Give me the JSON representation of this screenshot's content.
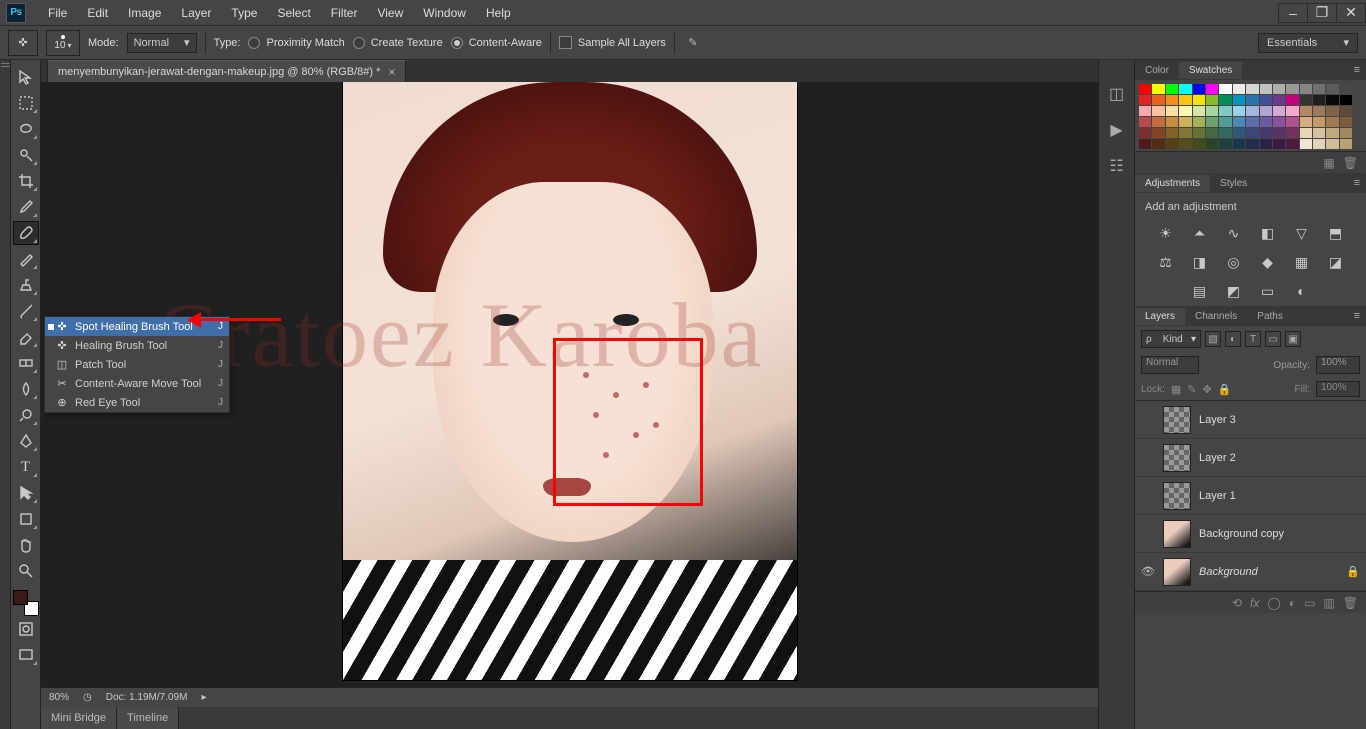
{
  "app": {
    "logo": "Ps"
  },
  "menu": [
    "File",
    "Edit",
    "Image",
    "Layer",
    "Type",
    "Select",
    "Filter",
    "View",
    "Window",
    "Help"
  ],
  "window_controls": [
    "–",
    "❐",
    "✕"
  ],
  "options": {
    "brush_size": "10",
    "mode_label": "Mode:",
    "mode_value": "Normal",
    "type_label": "Type:",
    "radios": [
      {
        "label": "Proximity Match",
        "on": false
      },
      {
        "label": "Create Texture",
        "on": false
      },
      {
        "label": "Content-Aware",
        "on": true
      }
    ],
    "sample_all": "Sample All Layers",
    "workspace": "Essentials"
  },
  "document": {
    "tab_title": "menyembunyikan-jerawat-dengan-makeup.jpg @ 80% (RGB/8#) *",
    "zoom": "80%",
    "doc_info": "Doc: 1.19M/7.09M"
  },
  "flyout": {
    "items": [
      {
        "label": "Spot Healing Brush Tool",
        "key": "J",
        "sel": true
      },
      {
        "label": "Healing Brush Tool",
        "key": "J",
        "sel": false
      },
      {
        "label": "Patch Tool",
        "key": "J",
        "sel": false
      },
      {
        "label": "Content-Aware Move Tool",
        "key": "J",
        "sel": false
      },
      {
        "label": "Red Eye Tool",
        "key": "J",
        "sel": false
      }
    ]
  },
  "bottom_tabs": [
    "Mini Bridge",
    "Timeline"
  ],
  "watermark": "Cratoez Karoba",
  "right": {
    "color_tabs": [
      "Color",
      "Swatches"
    ],
    "adjustments_tabs": [
      "Adjustments",
      "Styles"
    ],
    "adjustments_label": "Add an adjustment",
    "layers_tabs": [
      "Layers",
      "Channels",
      "Paths"
    ],
    "layers": {
      "kind_label": "Kind",
      "blend_mode": "Normal",
      "opacity_label": "Opacity:",
      "opacity_value": "100%",
      "lock_label": "Lock:",
      "fill_label": "Fill:",
      "fill_value": "100%",
      "items": [
        {
          "name": "Layer 3",
          "visible": false,
          "img": false
        },
        {
          "name": "Layer 2",
          "visible": false,
          "img": false
        },
        {
          "name": "Layer 1",
          "visible": false,
          "img": false
        },
        {
          "name": "Background copy",
          "visible": false,
          "img": true
        },
        {
          "name": "Background",
          "visible": true,
          "img": true,
          "locked": true,
          "italic": true
        }
      ]
    },
    "swatch_colors": [
      "#ff0000",
      "#ffff00",
      "#00ff00",
      "#00ffff",
      "#0000ff",
      "#ff00ff",
      "#ffffff",
      "#ebebeb",
      "#d6d6d6",
      "#c2c2c2",
      "#adadad",
      "#999999",
      "#858585",
      "#707070",
      "#5c5c5c",
      "#474747",
      "#e32322",
      "#ea621f",
      "#f18e1c",
      "#fdc60b",
      "#f4e500",
      "#8cbb26",
      "#008e5b",
      "#0696bb",
      "#2a71b0",
      "#444e99",
      "#6d398b",
      "#c4037d",
      "#333333",
      "#1f1f1f",
      "#0a0a0a",
      "#000000",
      "#f7aaad",
      "#f8c39a",
      "#fce0a7",
      "#fff6b1",
      "#d3e6a3",
      "#a7d59e",
      "#7fcbc4",
      "#9bd1ea",
      "#a1b7e2",
      "#b1a4d5",
      "#d6a8d3",
      "#f3aace",
      "#b58863",
      "#9c7a5a",
      "#81634a",
      "#5e4a38",
      "#b84a4a",
      "#c46c3f",
      "#c88e3e",
      "#cbb158",
      "#a2b452",
      "#6ca16b",
      "#4f9e94",
      "#4c88b3",
      "#5c6eae",
      "#6d5aa4",
      "#8a529e",
      "#b2528d",
      "#d6ae7e",
      "#c79a6a",
      "#a37a4f",
      "#7f5d3b",
      "#7a2f2f",
      "#804626",
      "#83612b",
      "#7e7736",
      "#657334",
      "#426b45",
      "#33685f",
      "#315878",
      "#3b4876",
      "#47396e",
      "#5a326a",
      "#762f61",
      "#e8d5b7",
      "#d7c19e",
      "#c0a87f",
      "#a28860",
      "#4e1a1a",
      "#532c14",
      "#573f17",
      "#544e1d",
      "#414b1c",
      "#284426",
      "#1e4239",
      "#1b374c",
      "#232c4c",
      "#2c2146",
      "#391c44",
      "#4b1a3c",
      "#efe6d5",
      "#e1d4ba",
      "#cfbd9a",
      "#b8a177"
    ]
  }
}
